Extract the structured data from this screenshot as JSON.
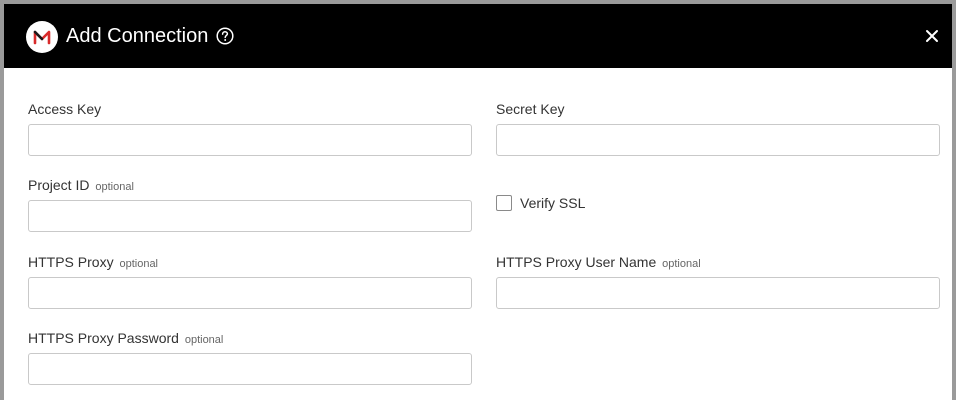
{
  "dialog": {
    "title": "Add Connection",
    "icons": {
      "logo": "brand-m-logo-icon",
      "help": "help-circle-icon",
      "close": "close-icon"
    },
    "colors": {
      "header_bg": "#000000",
      "logo_red": "#d92b2b",
      "border": "#9a9a9a"
    }
  },
  "form": {
    "access_key": {
      "label": "Access Key",
      "value": "",
      "placeholder": ""
    },
    "secret_key": {
      "label": "Secret Key",
      "value": "",
      "placeholder": ""
    },
    "project_id": {
      "label": "Project ID",
      "optional": "optional",
      "value": "",
      "placeholder": ""
    },
    "verify_ssl": {
      "label": "Verify SSL",
      "checked": false
    },
    "https_proxy": {
      "label": "HTTPS Proxy",
      "optional": "optional",
      "value": "",
      "placeholder": ""
    },
    "https_proxy_user": {
      "label": "HTTPS Proxy User Name",
      "optional": "optional",
      "value": "",
      "placeholder": ""
    },
    "https_proxy_password": {
      "label": "HTTPS Proxy Password",
      "optional": "optional",
      "value": "",
      "placeholder": ""
    }
  }
}
